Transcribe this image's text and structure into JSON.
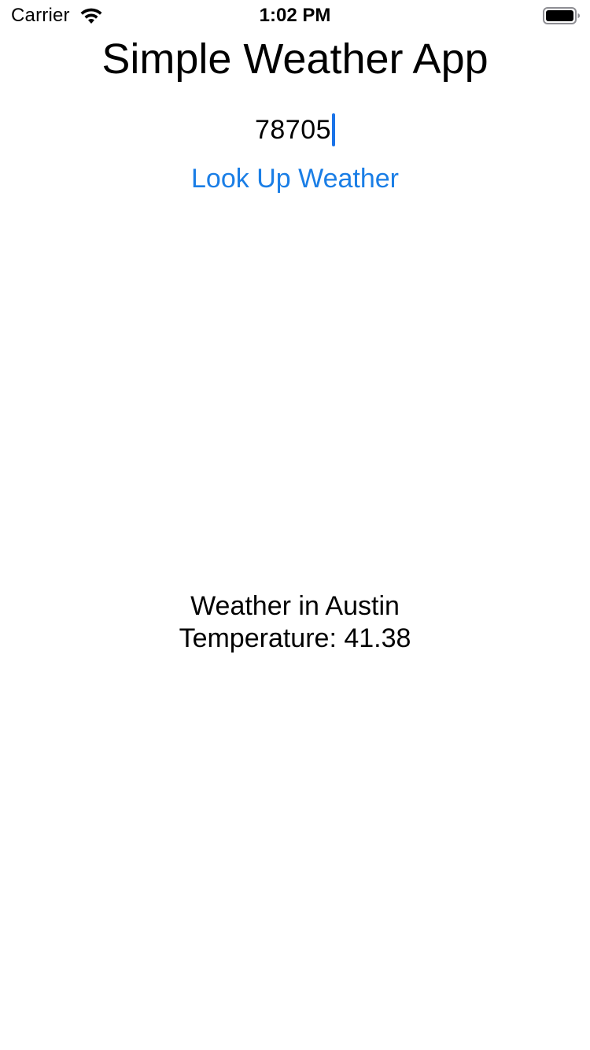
{
  "status_bar": {
    "carrier": "Carrier",
    "time": "1:02 PM",
    "wifi_icon": "wifi-icon",
    "battery_icon": "battery-icon"
  },
  "app": {
    "title": "Simple Weather App",
    "zip_input": {
      "value": "78705"
    },
    "lookup_button_label": "Look Up Weather",
    "result": {
      "location_line": "Weather in Austin",
      "temperature_line": "Temperature: 41.38"
    }
  },
  "colors": {
    "accent": "#1a7ee6",
    "caret": "#1a73e8",
    "text": "#000000",
    "background": "#ffffff"
  }
}
